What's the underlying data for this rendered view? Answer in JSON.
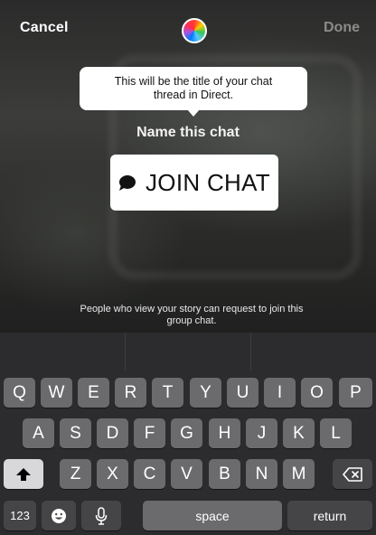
{
  "topbar": {
    "cancel_label": "Cancel",
    "done_label": "Done"
  },
  "tooltip": {
    "line1": "This will be the title of your chat",
    "line2": "thread in Direct."
  },
  "heading": "Name this chat",
  "sticker": {
    "icon": "chat-bubble-icon",
    "label": "JOIN CHAT"
  },
  "info": {
    "line1": "People who view your story can request to join this",
    "line2": "group chat."
  },
  "keyboard": {
    "row1": [
      "Q",
      "W",
      "E",
      "R",
      "T",
      "Y",
      "U",
      "I",
      "O",
      "P"
    ],
    "row2": [
      "A",
      "S",
      "D",
      "F",
      "G",
      "H",
      "J",
      "K",
      "L"
    ],
    "row3": [
      "Z",
      "X",
      "C",
      "V",
      "B",
      "N",
      "M"
    ],
    "numbers_label": "123",
    "space_label": "space",
    "return_label": "return"
  },
  "colors": {
    "keyboard_bg": "#2c2c2e",
    "key_bg": "#6b6b6e",
    "tooltip_bg": "#ffffff"
  }
}
